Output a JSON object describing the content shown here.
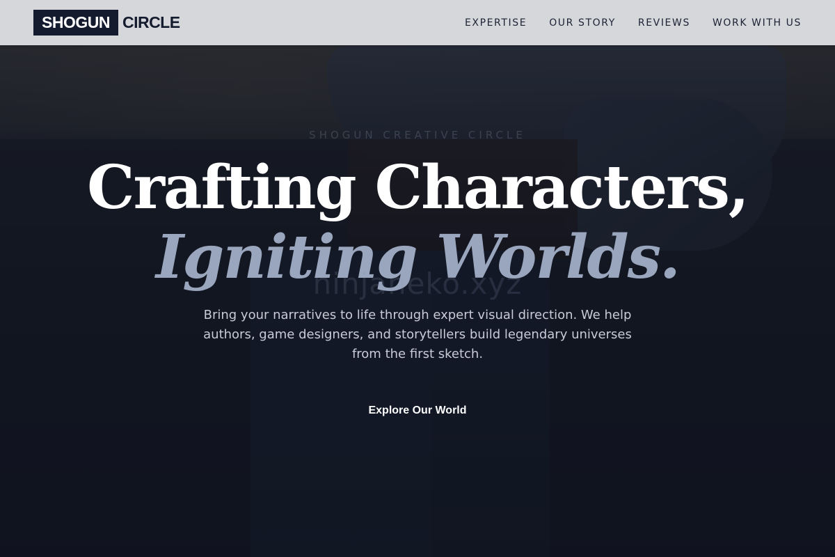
{
  "header": {
    "logo": {
      "box_text": "SHOGUN",
      "text": "CIRCLE"
    },
    "nav": [
      {
        "label": "EXPERTISE"
      },
      {
        "label": "OUR STORY"
      },
      {
        "label": "REVIEWS"
      },
      {
        "label": "WORK WITH US"
      }
    ]
  },
  "hero": {
    "eyebrow": "SHOGUN CREATIVE CIRCLE",
    "headline_line_1": "Crafting Characters,",
    "headline_line_2": "Igniting Worlds.",
    "watermark": "ninjaneko.xyz",
    "subtext": "Bring your narratives to life through expert visual direction. We help authors, game designers, and storytellers build legendary universes from the first sketch.",
    "cta_label": "Explore Our World"
  },
  "colors": {
    "header_bg": "#d5d7db",
    "brand_navy": "#141b2e",
    "headline_accent": "#9aa6bd",
    "hero_bg": "#151a27"
  }
}
